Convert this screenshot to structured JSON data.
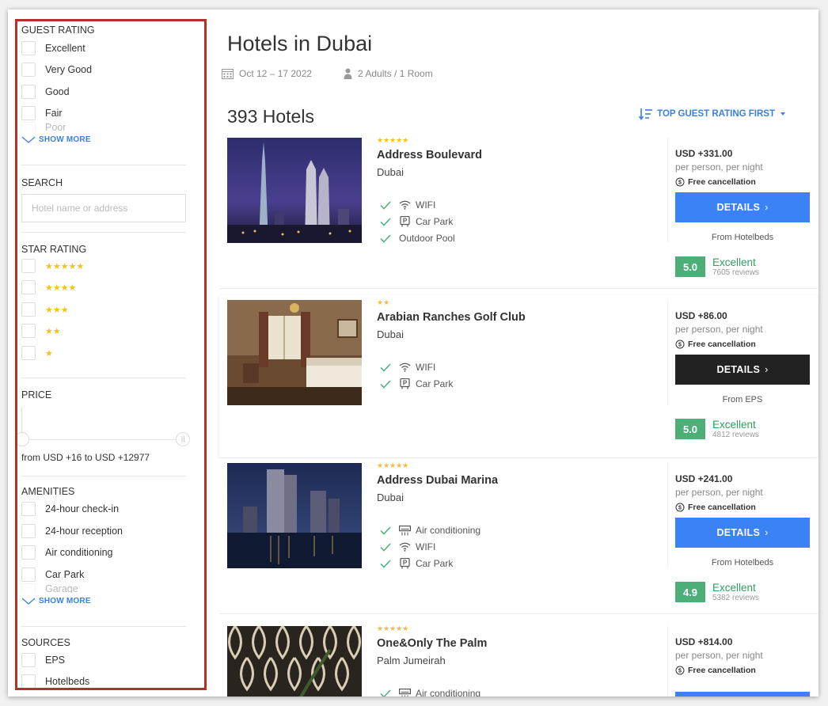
{
  "sidebar": {
    "guest_rating": {
      "title": "GUEST RATING",
      "options": [
        "Excellent",
        "Very Good",
        "Good",
        "Fair",
        "Poor"
      ],
      "show_more": "SHOW MORE"
    },
    "search": {
      "title": "SEARCH",
      "placeholder": "Hotel name or address"
    },
    "star_rating": {
      "title": "STAR RATING",
      "options": [
        "★★★★★",
        "★★★★",
        "★★★",
        "★★",
        "★"
      ]
    },
    "price": {
      "title": "PRICE",
      "range_text": "from USD +16 to USD +12977"
    },
    "amenities": {
      "title": "AMENITIES",
      "options": [
        "24-hour check-in",
        "24-hour reception",
        "Air conditioning",
        "Car Park",
        "Garage"
      ],
      "show_more": "SHOW MORE"
    },
    "sources": {
      "title": "SOURCES",
      "options": [
        "EPS",
        "Hotelbeds"
      ]
    }
  },
  "header": {
    "title": "Hotels in Dubai",
    "dates": "Oct 12 – 17 2022",
    "guests": "2 Adults / 1 Room"
  },
  "results": {
    "count": "393 Hotels",
    "sort_label": "TOP GUEST RATING FIRST"
  },
  "hotels": [
    {
      "stars": "★★★★★",
      "name": "Address Boulevard",
      "location": "Dubai",
      "amenities": [
        {
          "icon": "wifi-icon",
          "label": "WIFI"
        },
        {
          "icon": "parking-icon",
          "label": "Car Park"
        },
        {
          "icon": "",
          "label": "Outdoor Pool"
        }
      ],
      "price": "USD +331.00",
      "per": "per person, per night",
      "free_cancellation": "Free cancellation",
      "button": "DETAILS",
      "source": "From Hotelbeds",
      "rating": "5.0",
      "rating_word": "Excellent",
      "reviews": "7605 reviews"
    },
    {
      "stars": "★★",
      "name": "Arabian Ranches Golf Club",
      "location": "Dubai",
      "amenities": [
        {
          "icon": "wifi-icon",
          "label": "WIFI"
        },
        {
          "icon": "parking-icon",
          "label": "Car Park"
        }
      ],
      "price": "USD +86.00",
      "per": "per person, per night",
      "free_cancellation": "Free cancellation",
      "button": "DETAILS",
      "source": "From EPS",
      "rating": "5.0",
      "rating_word": "Excellent",
      "reviews": "4812 reviews"
    },
    {
      "stars": "★★★★★",
      "name": "Address Dubai Marina",
      "location": "Dubai",
      "amenities": [
        {
          "icon": "air-conditioning-icon",
          "label": "Air conditioning"
        },
        {
          "icon": "wifi-icon",
          "label": "WIFI"
        },
        {
          "icon": "parking-icon",
          "label": "Car Park"
        }
      ],
      "price": "USD +241.00",
      "per": "per person, per night",
      "free_cancellation": "Free cancellation",
      "button": "DETAILS",
      "source": "From Hotelbeds",
      "rating": "4.9",
      "rating_word": "Excellent",
      "reviews": "5382 reviews"
    },
    {
      "stars": "★★★★★",
      "name": "One&Only The Palm",
      "location": "Palm Jumeirah",
      "amenities": [
        {
          "icon": "air-conditioning-icon",
          "label": "Air conditioning"
        }
      ],
      "price": "USD +814.00",
      "per": "per person, per night",
      "free_cancellation": "Free cancellation"
    }
  ],
  "colors": {
    "accent_blue": "#3a82f6",
    "dark_button": "#222222",
    "star_gold": "#f2c318",
    "rating_green": "#4caf77",
    "highlight_border": "#b5302b"
  }
}
